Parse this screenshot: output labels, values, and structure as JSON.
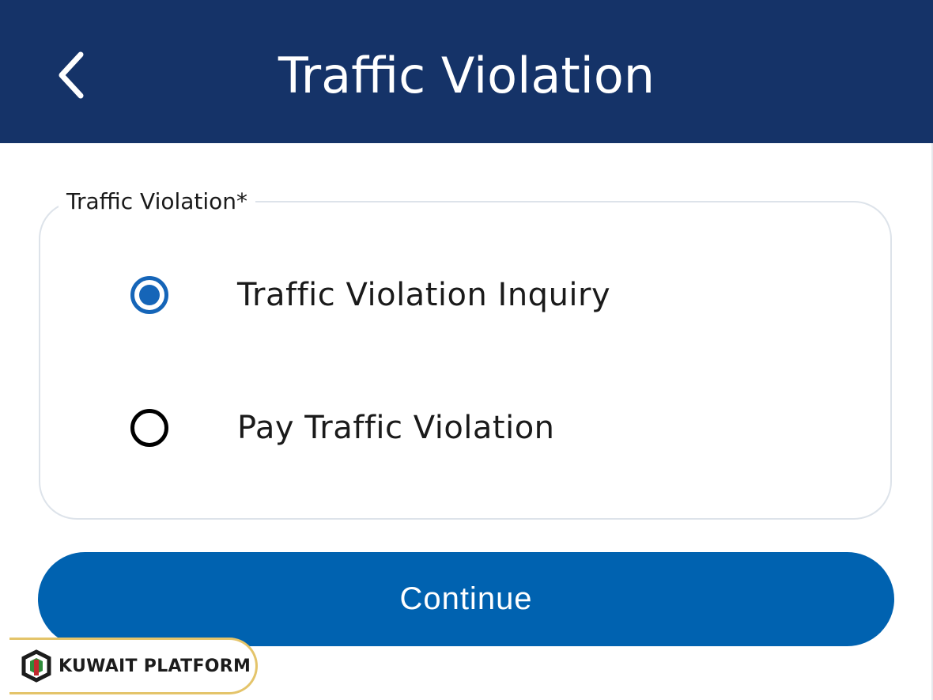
{
  "header": {
    "title": "Traffic Violation",
    "background_color": "#153368",
    "back_icon": "chevron-left-icon"
  },
  "form": {
    "legend": "Traffic Violation*",
    "options": [
      {
        "label": "Traffic Violation Inquiry",
        "selected": true
      },
      {
        "label": "Pay Traffic Violation",
        "selected": false
      }
    ],
    "accent_color": "#1565b8"
  },
  "continue_button": {
    "label": "Continue",
    "color": "#0062b0"
  },
  "watermark": {
    "text": "KUWAIT PLATFORM",
    "logo_icon": "kuwait-platform-logo-icon",
    "border_color": "#e4c46a"
  }
}
